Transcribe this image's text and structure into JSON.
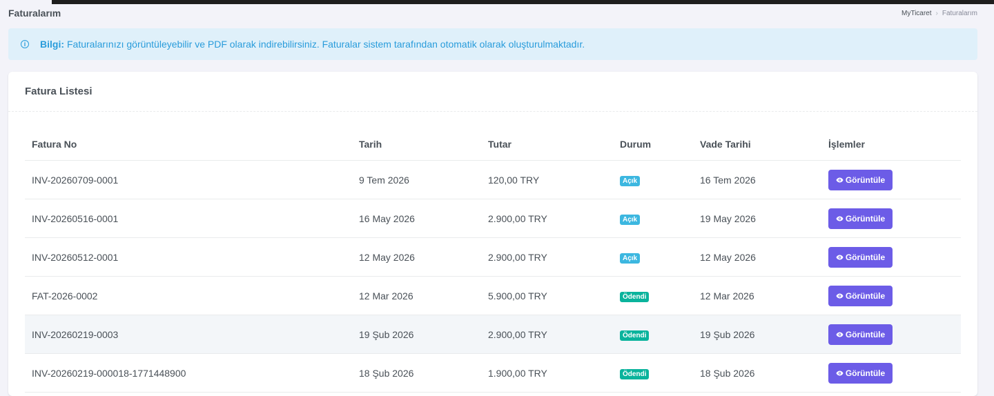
{
  "page": {
    "title": "Faturalarım",
    "breadcrumb": {
      "home": "MyTicaret",
      "separator": "›",
      "current": "Faturalarım"
    }
  },
  "alert": {
    "icon": "info-icon",
    "strong": "Bilgi:",
    "text": "Faturalarınızı görüntüleyebilir ve PDF olarak indirebilirsiniz. Faturalar sistem tarafından otomatik olarak oluşturulmaktadır."
  },
  "card": {
    "title": "Fatura Listesi",
    "columns": [
      "Fatura No",
      "Tarih",
      "Tutar",
      "Durum",
      "Vade Tarihi",
      "İşlemler"
    ],
    "rows": [
      {
        "no": "INV-20260709-0001",
        "date": "9 Tem 2026",
        "amount": "120,00 TRY",
        "status": "Açık",
        "status_type": "open",
        "due": "16 Tem 2026",
        "action": "Görüntüle"
      },
      {
        "no": "INV-20260516-0001",
        "date": "16 May 2026",
        "amount": "2.900,00 TRY",
        "status": "Açık",
        "status_type": "open",
        "due": "19 May 2026",
        "action": "Görüntüle"
      },
      {
        "no": "INV-20260512-0001",
        "date": "12 May 2026",
        "amount": "2.900,00 TRY",
        "status": "Açık",
        "status_type": "open",
        "due": "12 May 2026",
        "action": "Görüntüle"
      },
      {
        "no": "FAT-2026-0002",
        "date": "12 Mar 2026",
        "amount": "5.900,00 TRY",
        "status": "Ödendi",
        "status_type": "paid",
        "due": "12 Mar 2026",
        "action": "Görüntüle"
      },
      {
        "no": "INV-20260219-0003",
        "date": "19 Şub 2026",
        "amount": "2.900,00 TRY",
        "status": "Ödendi",
        "status_type": "paid",
        "due": "19 Şub 2026",
        "action": "Görüntüle",
        "hover": true
      },
      {
        "no": "INV-20260219-000018-1771448900",
        "date": "18 Şub 2026",
        "amount": "1.900,00 TRY",
        "status": "Ödendi",
        "status_type": "paid",
        "due": "18 Şub 2026",
        "action": "Görüntüle"
      }
    ]
  },
  "colors": {
    "accent": "#6c5ce7",
    "badge_open": "#3cb7e0",
    "badge_paid": "#0ab39c",
    "alert_bg": "#dff0fa",
    "alert_text": "#299cdb"
  }
}
